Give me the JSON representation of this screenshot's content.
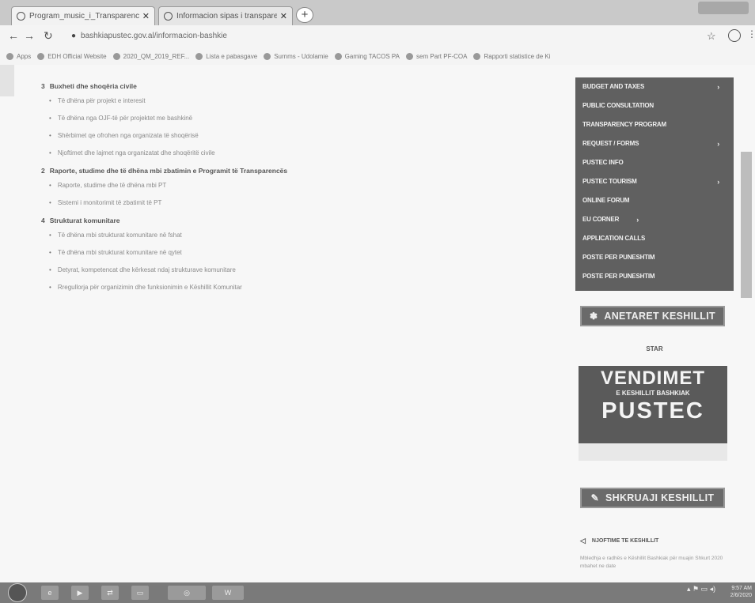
{
  "browser": {
    "tabs": [
      {
        "label": "Program_music_i_Transparence"
      },
      {
        "label": "Informacion sipas i transparenc"
      }
    ],
    "url": "bashkiapustec.gov.al/informacion-bashkie",
    "bookmarks": [
      "Apps",
      "EDH Official Website",
      "2020_QM_2019_REF...",
      "Lista e pabasgave",
      "Surnms - Udolamie",
      "Gaming TACOS PA",
      "sem Part PF-COA",
      "Rapporti statistice de Ki"
    ]
  },
  "content": {
    "sections": [
      {
        "num": "3",
        "title": "Buxheti dhe shoqëria civile",
        "items": [
          "Të dhëna për projekt e interesit",
          "Të dhëna nga OJF-të për projektet me bashkinë",
          "Shërbimet qe ofrohen nga organizata të shoqërisë",
          "Njoftimet dhe lajmet nga organizatat dhe shoqëritë civile"
        ]
      },
      {
        "num": "2",
        "title": "Raporte, studime dhe të dhëna mbi zbatimin e Programit të Transparencës",
        "items": [
          "Raporte, studime dhe të dhëna mbi PT",
          "Sistemi i monitorimit të zbatimit të PT"
        ]
      },
      {
        "num": "4",
        "title": "Strukturat komunitare",
        "items": [
          "Të dhëna mbi strukturat komunitare në fshat",
          "Të dhëna mbi strukturat komunitare në qytet",
          "Detyrat, kompetencat dhe kërkesat ndaj strukturave komunitare",
          "Rregullorja për organizimin dhe funksionimin e Këshillit Komunitar"
        ]
      }
    ]
  },
  "sidebar": {
    "menu": [
      {
        "label": "BUDGET AND TAXES",
        "arrow": "›"
      },
      {
        "label": "PUBLIC CONSULTATION",
        "arrow": ""
      },
      {
        "label": "TRANSPARENCY PROGRAM",
        "arrow": ""
      },
      {
        "label": "REQUEST / FORMS",
        "arrow": "›"
      },
      {
        "label": "PUSTEC INFO",
        "arrow": ""
      },
      {
        "label": "PUSTEC TOURISM",
        "arrow": "›"
      },
      {
        "label": "ONLINE FORUM",
        "arrow": ""
      },
      {
        "label": "EU CORNER",
        "arrow": "›"
      },
      {
        "label": "APPLICATION CALLS",
        "arrow": ""
      },
      {
        "label": "POSTE PER PUNESHTIM",
        "arrow": ""
      },
      {
        "label": "POSTE PER PUNESHTIM",
        "arrow": ""
      }
    ],
    "council_members_btn": "ANETARET KESHILLIT",
    "star_logo": "STAR",
    "poster": {
      "line1": "VENDIMET",
      "line2": "E KESHILLIT BASHKIAK",
      "line3": "PUSTEC"
    },
    "write_council_btn": "SHKRUAJI KESHILLIT",
    "news_title": "NJOFTIME TE KESHILLIT",
    "news_text": "Mbledhja e radhës e Këshillit Bashkiak për muajin Shkurt 2020 mbahet ne date"
  },
  "taskbar": {
    "clock_time": "9:57 AM",
    "clock_date": "2/6/2020"
  }
}
